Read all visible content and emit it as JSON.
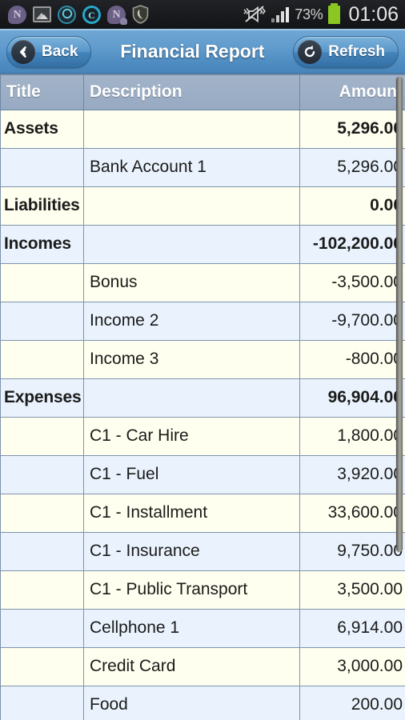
{
  "statusbar": {
    "notification_icons": [
      {
        "name": "note-bubble-icon",
        "glyph": "N"
      },
      {
        "name": "gallery-image-icon",
        "glyph": ""
      },
      {
        "name": "android-sync-icon",
        "glyph": "↻"
      },
      {
        "name": "opera-c-icon",
        "glyph": "C"
      },
      {
        "name": "note-bubble-alert-icon",
        "glyph": "N"
      },
      {
        "name": "security-shield-icon",
        "glyph": ""
      }
    ],
    "vibrate_off_icon": "vibrate-off-icon",
    "signal_icon": "signal-bars-icon",
    "battery_percent": "73%",
    "battery_icon": "battery-icon",
    "clock": "01:06"
  },
  "titlebar": {
    "back_label": "Back",
    "back_icon": "chevron-left-icon",
    "title": "Financial Report",
    "refresh_label": "Refresh",
    "refresh_icon": "refresh-icon",
    "accent_color": "#5e9acc"
  },
  "table": {
    "columns": [
      "Title",
      "Description",
      "Amount"
    ],
    "row_colors": {
      "odd": "#ffffef",
      "even": "#eaf3fd",
      "header": "#9daec5",
      "border": "#7e93ad"
    },
    "rows": [
      {
        "title": "Assets",
        "description": "",
        "amount": "5,296.00",
        "group": true
      },
      {
        "title": "",
        "description": "Bank Account 1",
        "amount": "5,296.00",
        "group": false
      },
      {
        "title": "Liabilities",
        "description": "",
        "amount": "0.00",
        "group": true
      },
      {
        "title": "Incomes",
        "description": "",
        "amount": "-102,200.00",
        "group": true
      },
      {
        "title": "",
        "description": "Bonus",
        "amount": "-3,500.00",
        "group": false
      },
      {
        "title": "",
        "description": "Income 2",
        "amount": "-9,700.00",
        "group": false
      },
      {
        "title": "",
        "description": "Income 3",
        "amount": "-800.00",
        "group": false
      },
      {
        "title": "Expenses",
        "description": "",
        "amount": "96,904.00",
        "group": true
      },
      {
        "title": "",
        "description": "C1 - Car Hire",
        "amount": "1,800.00",
        "group": false
      },
      {
        "title": "",
        "description": "C1 - Fuel",
        "amount": "3,920.00",
        "group": false
      },
      {
        "title": "",
        "description": "C1 - Installment",
        "amount": "33,600.00",
        "group": false
      },
      {
        "title": "",
        "description": "C1 - Insurance",
        "amount": "9,750.00",
        "group": false
      },
      {
        "title": "",
        "description": "C1 - Public Transport",
        "amount": "3,500.00",
        "group": false
      },
      {
        "title": "",
        "description": "Cellphone 1",
        "amount": "6,914.00",
        "group": false
      },
      {
        "title": "",
        "description": "Credit Card",
        "amount": "3,000.00",
        "group": false
      },
      {
        "title": "",
        "description": "Food",
        "amount": "200.00",
        "group": false
      }
    ]
  }
}
